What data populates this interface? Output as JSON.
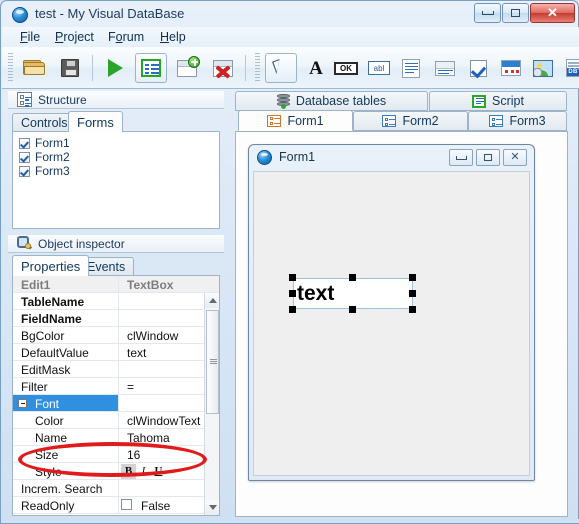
{
  "window": {
    "title": "test - My Visual DataBase",
    "icon": "app-globe-icon",
    "buttons": {
      "minimize": "minimize",
      "maximize": "maximize",
      "close": "close"
    }
  },
  "menu": {
    "items": [
      {
        "label": "File",
        "mnemonic": "F"
      },
      {
        "label": "Project",
        "mnemonic": "P"
      },
      {
        "label": "Forum",
        "mnemonic": "o"
      },
      {
        "label": "Help",
        "mnemonic": "H"
      }
    ]
  },
  "toolbar_main": {
    "buttons": [
      {
        "name": "open-project",
        "icon": "folder-open-icon"
      },
      {
        "name": "save-project",
        "icon": "floppy-save-icon"
      },
      {
        "name": "run-project",
        "icon": "play-run-icon"
      },
      {
        "name": "form-designer",
        "icon": "form-list-icon",
        "pressed": true
      },
      {
        "name": "new-form",
        "icon": "window-add-icon"
      },
      {
        "name": "delete-form",
        "icon": "window-delete-icon"
      }
    ]
  },
  "toolbar_controls": {
    "buttons": [
      {
        "name": "select-tool",
        "icon": "cursor-arrow-icon",
        "pressed": true
      },
      {
        "name": "label-tool",
        "icon": "letter-a-icon",
        "glyph": "A"
      },
      {
        "name": "button-tool",
        "icon": "ok-button-icon",
        "glyph": "OK"
      },
      {
        "name": "textbox-tool",
        "icon": "abl-textbox-icon",
        "glyph": "abl"
      },
      {
        "name": "memo-tool",
        "icon": "memo-lines-icon"
      },
      {
        "name": "combobox-tool",
        "icon": "combobox-icon"
      },
      {
        "name": "checkbox-tool",
        "icon": "checkbox-icon"
      },
      {
        "name": "datepicker-tool",
        "icon": "calendar-icon"
      },
      {
        "name": "image-tool",
        "icon": "image-db-icon"
      },
      {
        "name": "datagrid-tool",
        "icon": "dbt-grid-icon",
        "glyph": "DBT"
      }
    ]
  },
  "structure_panel": {
    "title": "Structure",
    "icon": "structure-icon",
    "tabs": [
      {
        "label": "Controls",
        "active": false
      },
      {
        "label": "Forms",
        "active": true
      }
    ],
    "forms": [
      {
        "label": "Form1",
        "checked": true
      },
      {
        "label": "Form2",
        "checked": true
      },
      {
        "label": "Form3",
        "checked": true
      }
    ]
  },
  "object_inspector": {
    "title": "Object inspector",
    "icon": "inspector-icon",
    "tabs": [
      {
        "label": "Properties",
        "active": true
      },
      {
        "label": "Events",
        "active": false
      }
    ],
    "header": {
      "object_name": "Edit1",
      "object_class": "TextBox"
    },
    "rows": [
      {
        "name": "TableName",
        "value": "",
        "bold": true,
        "indent": false,
        "kind": "text"
      },
      {
        "name": "FieldName",
        "value": "",
        "bold": true,
        "indent": false,
        "kind": "text"
      },
      {
        "name": "BgColor",
        "value": "clWindow",
        "bold": false,
        "indent": false,
        "kind": "text"
      },
      {
        "name": "DefaultValue",
        "value": "text",
        "bold": false,
        "indent": false,
        "kind": "text"
      },
      {
        "name": "EditMask",
        "value": "",
        "bold": false,
        "indent": false,
        "kind": "text"
      },
      {
        "name": "Filter",
        "value": "=",
        "bold": false,
        "indent": false,
        "kind": "text"
      },
      {
        "name": "Font",
        "value": "",
        "bold": false,
        "indent": false,
        "kind": "group",
        "selected": true,
        "expanded": true
      },
      {
        "name": "Color",
        "value": "clWindowText",
        "bold": false,
        "indent": true,
        "kind": "text"
      },
      {
        "name": "Name",
        "value": "Tahoma",
        "bold": false,
        "indent": true,
        "kind": "text"
      },
      {
        "name": "Size",
        "value": "16",
        "bold": false,
        "indent": true,
        "kind": "text",
        "highlighted": true
      },
      {
        "name": "Style",
        "value": "",
        "bold": false,
        "indent": true,
        "kind": "style"
      },
      {
        "name": "Increm. Search",
        "value": "",
        "bold": false,
        "indent": false,
        "kind": "text"
      },
      {
        "name": "ReadOnly",
        "value": "False",
        "bold": false,
        "indent": false,
        "kind": "checkbox"
      }
    ],
    "style_buttons": [
      {
        "name": "bold",
        "glyph": "B",
        "pressed": true
      },
      {
        "name": "italic",
        "glyph": "I",
        "pressed": false
      },
      {
        "name": "underline",
        "glyph": "U",
        "pressed": false
      }
    ],
    "annotation": {
      "shape": "ellipse",
      "color": "#e01b1b",
      "targets": "Size 16 row"
    }
  },
  "workspace": {
    "top_tabs": [
      {
        "label": "Database tables",
        "icon": "database-icon",
        "active": false
      },
      {
        "label": "Script",
        "icon": "script-icon",
        "active": false
      }
    ],
    "form_tabs": [
      {
        "label": "Form1",
        "icon": "form-icon",
        "active": true
      },
      {
        "label": "Form2",
        "icon": "form-icon",
        "active": false
      },
      {
        "label": "Form3",
        "icon": "form-icon",
        "active": false
      }
    ],
    "design_form": {
      "title": "Form1",
      "icon": "app-globe-icon",
      "buttons": {
        "minimize": "minimize",
        "maximize": "maximize",
        "close": "close"
      },
      "controls": [
        {
          "type": "TextBox",
          "name": "Edit1",
          "text": "text",
          "selected": true
        }
      ]
    }
  }
}
